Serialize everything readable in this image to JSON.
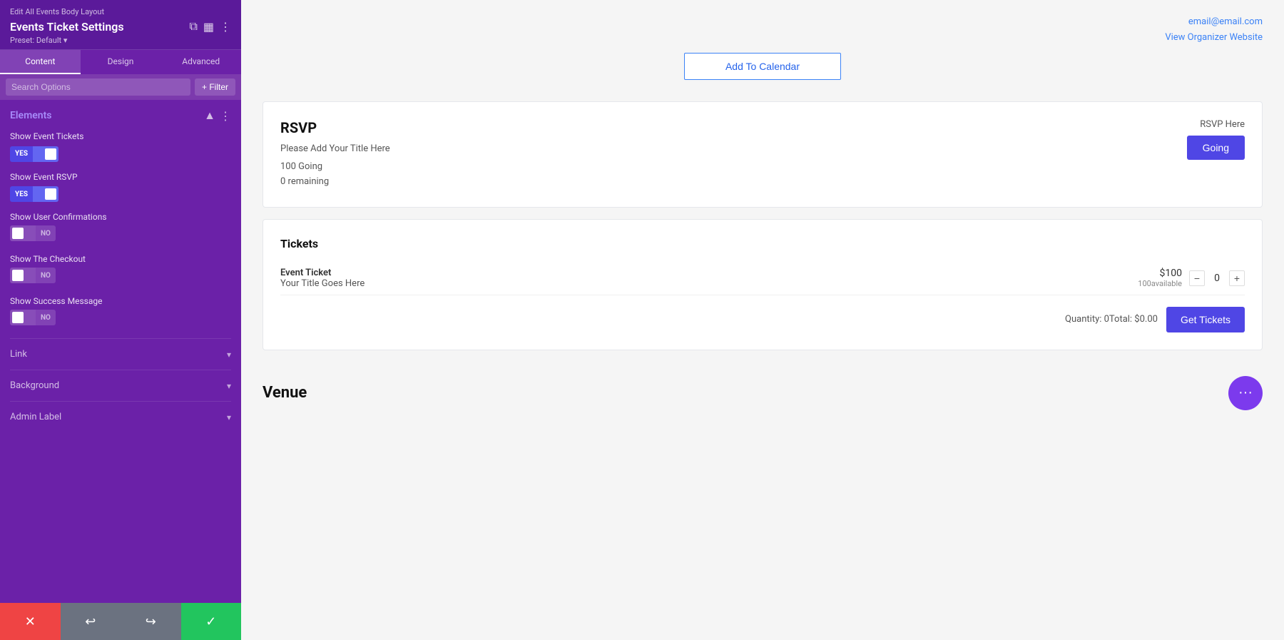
{
  "header": {
    "edit_label": "Edit All Events Body Layout",
    "title": "Events Ticket Settings",
    "preset_label": "Preset: Default",
    "icons": [
      "copy-icon",
      "grid-icon",
      "more-icon"
    ]
  },
  "tabs": [
    {
      "label": "Content",
      "active": true
    },
    {
      "label": "Design",
      "active": false
    },
    {
      "label": "Advanced",
      "active": false
    }
  ],
  "search": {
    "placeholder": "Search Options",
    "filter_label": "+ Filter"
  },
  "sections": {
    "elements": {
      "title": "Elements",
      "options": [
        {
          "label": "Show Event Tickets",
          "toggle_state": "yes",
          "toggle_on": true
        },
        {
          "label": "Show Event RSVP",
          "toggle_state": "yes",
          "toggle_on": true
        },
        {
          "label": "Show User Confirmations",
          "toggle_state": "no",
          "toggle_on": false
        },
        {
          "label": "Show The Checkout",
          "toggle_state": "no",
          "toggle_on": false
        },
        {
          "label": "Show Success Message",
          "toggle_state": "no",
          "toggle_on": false
        }
      ]
    },
    "link": {
      "label": "Link"
    },
    "background": {
      "label": "Background"
    },
    "admin_label": {
      "label": "Admin Label"
    }
  },
  "bottom_bar": {
    "cancel_icon": "✕",
    "undo_icon": "↩",
    "redo_icon": "↪",
    "save_icon": "✓"
  },
  "main": {
    "top_links": {
      "email": "email@email.com",
      "website": "View Organizer Website"
    },
    "add_to_calendar_label": "Add To Calendar",
    "rsvp_card": {
      "title": "RSVP",
      "subtitle": "Please Add Your Title Here",
      "going_count": "100 Going",
      "remaining": "0 remaining",
      "rsvp_here_label": "RSVP Here",
      "going_btn_label": "Going"
    },
    "tickets_card": {
      "title": "Tickets",
      "ticket_name": "Event Ticket",
      "ticket_subtitle": "Your Title Goes Here",
      "price": "$100",
      "available": "100available",
      "qty": "0",
      "qty_minus": "−",
      "qty_plus": "+",
      "footer_label": "Quantity: 0Total: $0.00",
      "get_tickets_label": "Get Tickets"
    },
    "venue": {
      "title": "Venue",
      "fab_icon": "•••"
    }
  }
}
